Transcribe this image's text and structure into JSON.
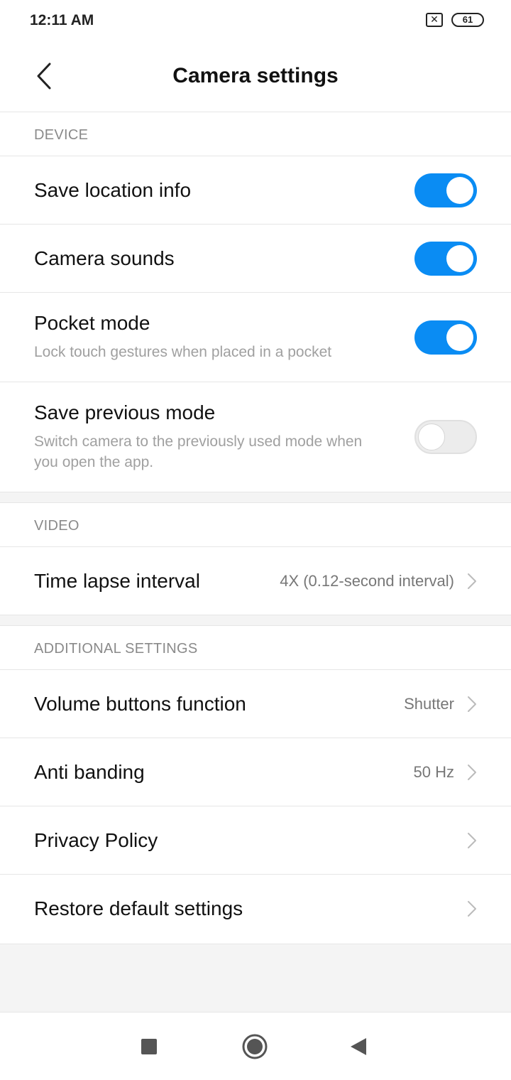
{
  "status_bar": {
    "time": "12:11 AM",
    "sim": "✕",
    "battery": "61"
  },
  "header": {
    "title": "Camera settings"
  },
  "sections": {
    "device": {
      "title": "DEVICE",
      "items": [
        {
          "title": "Save location info",
          "toggle": true
        },
        {
          "title": "Camera sounds",
          "toggle": true
        },
        {
          "title": "Pocket mode",
          "subtitle": "Lock touch gestures when placed in a pocket",
          "toggle": true
        },
        {
          "title": "Save previous mode",
          "subtitle": "Switch camera to the previously used mode when you open the app.",
          "toggle": false
        }
      ]
    },
    "video": {
      "title": "VIDEO",
      "items": [
        {
          "title": "Time lapse interval",
          "value": "4X (0.12-second interval)"
        }
      ]
    },
    "additional": {
      "title": "ADDITIONAL SETTINGS",
      "items": [
        {
          "title": "Volume buttons function",
          "value": "Shutter"
        },
        {
          "title": "Anti banding",
          "value": "50 Hz"
        },
        {
          "title": "Privacy Policy",
          "value": ""
        },
        {
          "title": "Restore default settings",
          "value": ""
        }
      ]
    }
  },
  "icons": {
    "back": "back-arrow-icon",
    "chevron": "chevron-right-icon",
    "nav_recent": "square-icon",
    "nav_home": "circle-icon",
    "nav_back": "triangle-back-icon"
  },
  "colors": {
    "accent": "#0a8cf3",
    "toggle_off": "#ececec"
  }
}
